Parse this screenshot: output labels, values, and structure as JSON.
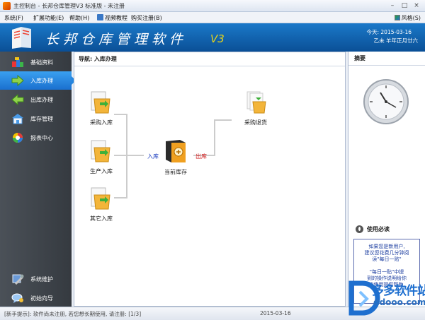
{
  "window": {
    "title": "主控制台 - 长邦仓库管理V3 标准版 - 未注册"
  },
  "menu": {
    "items": [
      "系统(F)",
      "扩展功能(E)",
      "帮助(H)",
      "视频教程",
      "购买注册(B)"
    ],
    "skin": "风格(S)"
  },
  "banner": {
    "app_title": "长邦仓库管理软件",
    "version": "V3",
    "date": "今天: 2015-03-16",
    "lunar": "乙未 羊年正月廿六"
  },
  "sidebar": {
    "items": [
      {
        "label": "基础资料",
        "icon": "building-blocks-icon"
      },
      {
        "label": "入库办理",
        "icon": "arrow-right-icon",
        "active": true
      },
      {
        "label": "出库办理",
        "icon": "arrow-left-icon"
      },
      {
        "label": "库存管理",
        "icon": "warehouse-icon"
      },
      {
        "label": "报表中心",
        "icon": "chart-wheel-icon"
      }
    ],
    "bottom_items": [
      {
        "label": "系统维护",
        "icon": "tools-icon"
      },
      {
        "label": "初始向导",
        "icon": "chat-guide-icon"
      }
    ]
  },
  "breadcrumb": {
    "prefix": "导航:",
    "page": "入库办理"
  },
  "flow": {
    "purchase_in": "采购入库",
    "production_in": "生产入库",
    "other_in": "其它入库",
    "in_label": "入库",
    "out_label": "出库",
    "current_stock": "当前库存",
    "purchase_return": "采购退货"
  },
  "right_panel": {
    "title": "摘要",
    "must_read": "使用必读",
    "notice_lines": [
      "如果您是新用户,",
      "建议您花费几分钟阅",
      "读\"每日一贴\"",
      "",
      "\"每日一贴\"中提",
      "到的操作说明给你",
      "的使用提供帮助."
    ]
  },
  "status": {
    "tip": "[新手提示]: 软件尚未注册, 若您想长期使用, 请注册: [1/3]",
    "date": "2015-03-16"
  },
  "watermark": {
    "text": "多多软件站",
    "url": "ddooo.com"
  },
  "colors": {
    "banner": "#0f5fa9",
    "sidebar": "#3f444a",
    "active": "#2587e0",
    "in": "#1d3fc0",
    "out": "#d21b1b"
  }
}
